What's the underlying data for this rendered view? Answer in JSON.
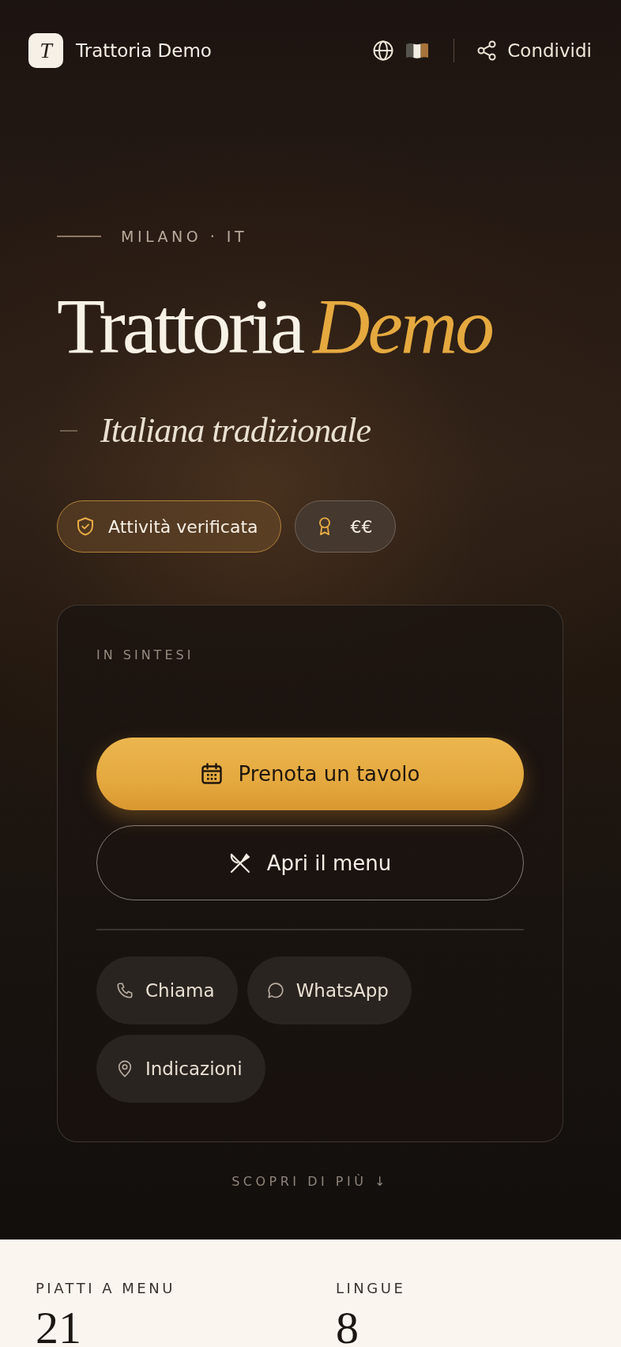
{
  "header": {
    "logo_letter": "T",
    "title": "Trattoria Demo",
    "share_label": "Condividi"
  },
  "hero": {
    "eyebrow": "MILANO · IT",
    "title": "Trattoria",
    "title_accent": "Demo",
    "subtitle": "Italiana tradizionale",
    "badges": [
      {
        "kind": "verified",
        "label": "Attività verificata"
      },
      {
        "kind": "price",
        "label": "€€"
      }
    ]
  },
  "summary": {
    "heading": "IN SINTESI",
    "actions": [
      {
        "kind": "reserve",
        "label": "Prenota un tavolo"
      },
      {
        "kind": "menu",
        "label": "Apri il menu"
      }
    ],
    "contacts": [
      {
        "kind": "call",
        "label": "Chiama"
      },
      {
        "kind": "whatsapp",
        "label": "WhatsApp"
      },
      {
        "kind": "directions",
        "label": "Indicazioni"
      }
    ]
  },
  "more_link": "SCOPRI DI PIÙ ↓",
  "stats": [
    {
      "label": "PIATTI A MENU",
      "value": "21"
    },
    {
      "label": "LINGUE",
      "value": "8"
    }
  ]
}
